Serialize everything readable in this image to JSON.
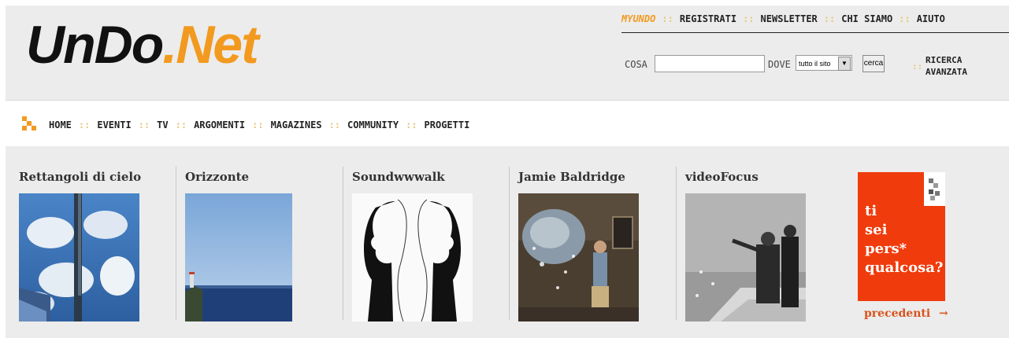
{
  "logo": {
    "undo": "UnDo",
    "dot": ".",
    "net": "Net"
  },
  "toplinks": [
    {
      "label": "MYUNDO"
    },
    {
      "label": "REGISTRATI"
    },
    {
      "label": "NEWSLETTER"
    },
    {
      "label": "CHI SIAMO"
    },
    {
      "label": "AIUTO"
    }
  ],
  "separator": "::",
  "search": {
    "cosa_label": "COSA",
    "cosa_value": "",
    "dove_label": "DOVE",
    "dove_value": "tutto il sito",
    "button": "cerca"
  },
  "ricerca_avanzata": {
    "line1": "RICERCA",
    "line2": "AVANZATA"
  },
  "nav": [
    "HOME",
    "EVENTI",
    "TV",
    "ARGOMENTI",
    "MAGAZINES",
    "COMMUNITY",
    "PROGETTI"
  ],
  "cards": [
    {
      "title": "Rettangoli di cielo",
      "image": "mirrored-building-sky-photo"
    },
    {
      "title": "Orizzonte",
      "image": "sea-horizon-photo"
    },
    {
      "title": "Soundwwwalk",
      "image": "two-silhouette-heads-drawing"
    },
    {
      "title": "Jamie Baldridge",
      "image": "surreal-room-figure-photo"
    },
    {
      "title": "videoFocus",
      "image": "men-by-water-bw-photo"
    }
  ],
  "promo": {
    "text": "ti\nsei\npers*\nqualcosa?"
  },
  "precedenti": {
    "label": "precedenti",
    "arrow": "→"
  },
  "colors": {
    "brand_orange": "#f29a1f",
    "promo_red": "#f03b0c",
    "header_gray": "#ececec"
  }
}
